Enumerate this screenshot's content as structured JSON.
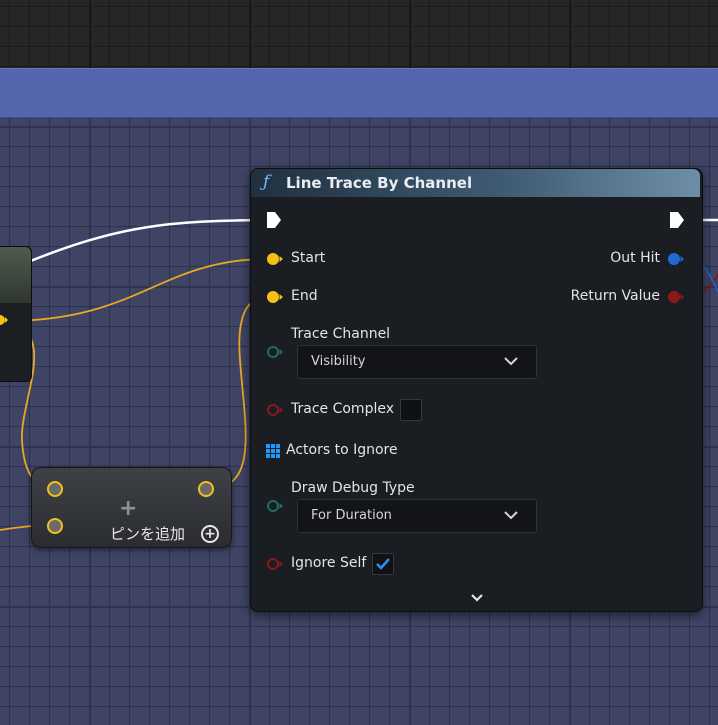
{
  "node": {
    "title": "Line Trace By Channel",
    "func_icon": "function-icon",
    "inputs": {
      "start": "Start",
      "end": "End",
      "trace_channel": "Trace Channel",
      "trace_complex": "Trace Complex",
      "actors_to_ignore": "Actors to Ignore",
      "draw_debug_type": "Draw Debug Type",
      "ignore_self": "Ignore Self"
    },
    "outputs": {
      "out_hit": "Out Hit",
      "return_value": "Return Value"
    },
    "trace_channel_value": "Visibility",
    "draw_debug_type_value": "For Duration",
    "trace_complex_checked": false,
    "ignore_self_checked": true
  },
  "make_array_node": {
    "add_pin_label": "ピンを追加",
    "plus_icon": "plus-icon",
    "add_icon": "add-circle-icon"
  },
  "colors": {
    "vector_pin": "#f4c018",
    "bool_pin": "#8a1a1a",
    "byte_pin": "#1f6b66",
    "struct_pin": "#1e6bd6",
    "exec_pin": "#ffffff",
    "comment": "#5565ae"
  }
}
